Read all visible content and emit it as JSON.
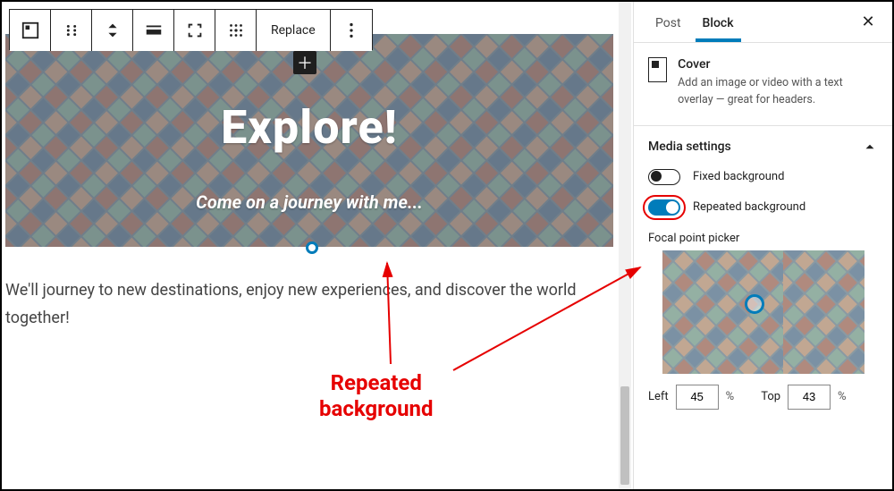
{
  "toolbar": {
    "replace_label": "Replace"
  },
  "cover": {
    "title": "Explore!",
    "subtitle": "Come on a journey with me..."
  },
  "paragraph": "We'll journey to new destinations, enjoy new experiences, and discover the world together!",
  "sidebar": {
    "tabs": {
      "post": "Post",
      "block": "Block"
    },
    "block": {
      "name": "Cover",
      "description": "Add an image or video with a text overlay — great for headers."
    },
    "panel_title": "Media settings",
    "toggles": {
      "fixed": {
        "label": "Fixed background",
        "value": false
      },
      "repeated": {
        "label": "Repeated background",
        "value": true
      }
    },
    "focal": {
      "label": "Focal point picker",
      "left_label": "Left",
      "left_value": "45",
      "top_label": "Top",
      "top_value": "43",
      "pct": "%"
    }
  },
  "annotation": {
    "line1": "Repeated",
    "line2": "background"
  }
}
